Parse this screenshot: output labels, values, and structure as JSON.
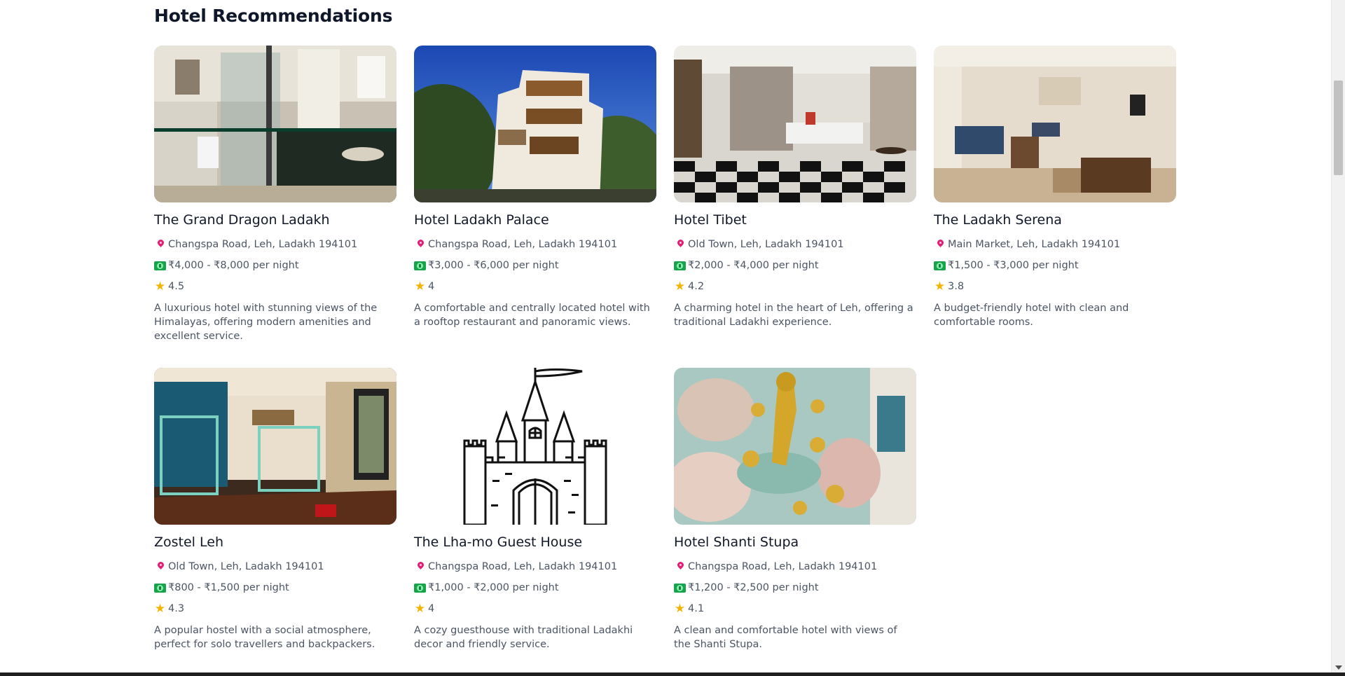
{
  "section": {
    "title": "Hotel Recommendations"
  },
  "icons": {
    "location": "location-pin-icon",
    "price": "money-icon",
    "rating": "star-icon"
  },
  "hotels": [
    {
      "name": "The Grand Dragon Ladakh",
      "address": "Changspa Road, Leh, Ladakh 194101",
      "price": "₹4,000 - ₹8,000 per night",
      "rating": "4.5",
      "description": "A luxurious hotel with stunning views of the Himalayas, offering modern amenities and excellent service.",
      "photo": "bathroom"
    },
    {
      "name": "Hotel Ladakh Palace",
      "address": "Changspa Road, Leh, Ladakh 194101",
      "price": "₹3,000 - ₹6,000 per night",
      "rating": "4",
      "description": "A comfortable and centrally located hotel with a rooftop restaurant and panoramic views.",
      "photo": "palace"
    },
    {
      "name": "Hotel Tibet",
      "address": "Old Town, Leh, Ladakh 194101",
      "price": "₹2,000 - ₹4,000 per night",
      "rating": "4.2",
      "description": "A charming hotel in the heart of Leh, offering a traditional Ladakhi experience.",
      "photo": "cafe"
    },
    {
      "name": "The Ladakh Serena",
      "address": "Main Market, Leh, Ladakh 194101",
      "price": "₹1,500 - ₹3,000 per night",
      "rating": "3.8",
      "description": "A budget-friendly hotel with clean and comfortable rooms.",
      "photo": "lounge"
    },
    {
      "name": "Zostel Leh",
      "address": "Old Town, Leh, Ladakh 194101",
      "price": "₹800 - ₹1,500 per night",
      "rating": "4.3",
      "description": "A popular hostel with a social atmosphere, perfect for solo travellers and backpackers.",
      "photo": "dorm"
    },
    {
      "name": "The Lha-mo Guest House",
      "address": "Changspa Road, Leh, Ladakh 194101",
      "price": "₹1,000 - ₹2,000 per night",
      "rating": "4",
      "description": "A cozy guesthouse with traditional Ladakhi decor and friendly service.",
      "photo": "castle"
    },
    {
      "name": "Hotel Shanti Stupa",
      "address": "Changspa Road, Leh, Ladakh 194101",
      "price": "₹1,200 - ₹2,500 per night",
      "rating": "4.1",
      "description": "A clean and comfortable hotel with views of the Shanti Stupa.",
      "photo": "carving"
    }
  ]
}
